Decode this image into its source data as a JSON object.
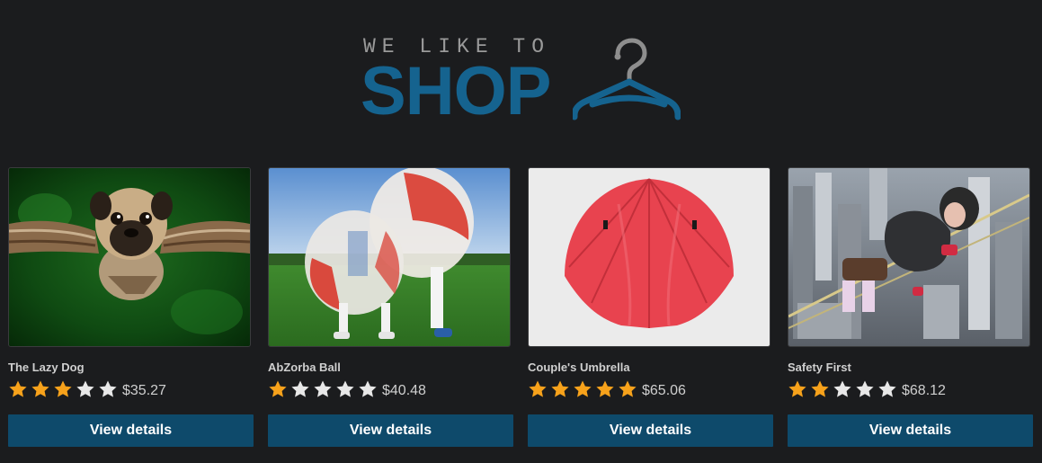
{
  "logo": {
    "tagline": "WE LIKE TO",
    "title": "SHOP"
  },
  "colors": {
    "background": "#1b1c1e",
    "brand": "#15638f",
    "button": "#0e4a6b",
    "star_filled": "#f7a21b",
    "star_empty": "#e8e8e8"
  },
  "products": [
    {
      "name": "The Lazy Dog",
      "rating": 3,
      "max_rating": 5,
      "price": "$35.27",
      "button_label": "View details",
      "image": "flying-pug-photo"
    },
    {
      "name": "AbZorba Ball",
      "rating": 1,
      "max_rating": 5,
      "price": "$40.48",
      "button_label": "View details",
      "image": "bubble-soccer-photo"
    },
    {
      "name": "Couple's Umbrella",
      "rating": 5,
      "max_rating": 5,
      "price": "$65.06",
      "button_label": "View details",
      "image": "red-umbrella-photo"
    },
    {
      "name": "Safety First",
      "rating": 2,
      "max_rating": 5,
      "price": "$68.12",
      "button_label": "View details",
      "image": "tightrope-city-photo"
    }
  ]
}
